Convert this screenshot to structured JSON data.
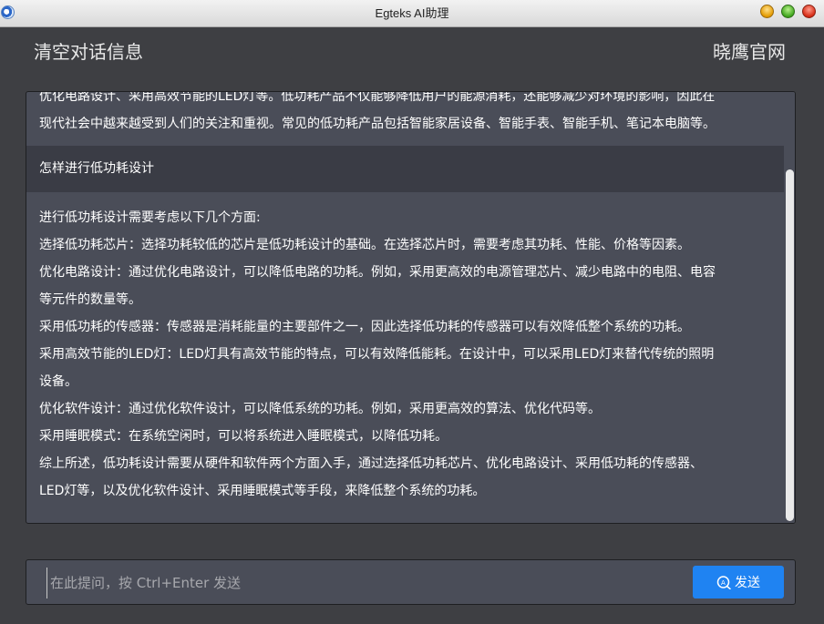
{
  "window": {
    "title": "Egteks AI助理"
  },
  "header": {
    "clear_label": "清空对话信息",
    "site_label": "晓鹰官网"
  },
  "chat": {
    "previous_answer": [
      "优化电路设计、采用高效节能的LED灯等。低功耗产品不仅能够降低用户的能源消耗，还能够减少对环境的影响，因此在",
      "现代社会中越来越受到人们的关注和重视。常见的低功耗产品包括智能家居设备、智能手表、智能手机、笔记本电脑等。"
    ],
    "question": "怎样进行低功耗设计",
    "answer": [
      "进行低功耗设计需要考虑以下几个方面:",
      "选择低功耗芯片：选择功耗较低的芯片是低功耗设计的基础。在选择芯片时，需要考虑其功耗、性能、价格等因素。",
      "优化电路设计：通过优化电路设计，可以降低电路的功耗。例如，采用更高效的电源管理芯片、减少电路中的电阻、电容",
      "等元件的数量等。",
      "采用低功耗的传感器：传感器是消耗能量的主要部件之一，因此选择低功耗的传感器可以有效降低整个系统的功耗。",
      "采用高效节能的LED灯：LED灯具有高效节能的特点，可以有效降低能耗。在设计中，可以采用LED灯来替代传统的照明",
      "设备。",
      "优化软件设计：通过优化软件设计，可以降低系统的功耗。例如，采用更高效的算法、优化代码等。",
      "采用睡眠模式：在系统空闲时，可以将系统进入睡眠模式，以降低功耗。",
      "综上所述，低功耗设计需要从硬件和软件两个方面入手，通过选择低功耗芯片、优化电路设计、采用低功耗的传感器、",
      "LED灯等，以及优化软件设计、采用睡眠模式等手段，来降低整个系统的功耗。"
    ]
  },
  "input": {
    "placeholder": "在此提问，按 Ctrl+Enter 发送",
    "value": ""
  },
  "send_button": {
    "label": "发送",
    "icon": "send-chat-icon",
    "color": "#1f83f2"
  },
  "colors": {
    "background": "#3e3f43",
    "panel": "#4a4d58",
    "question_bg": "#3a3c45"
  }
}
